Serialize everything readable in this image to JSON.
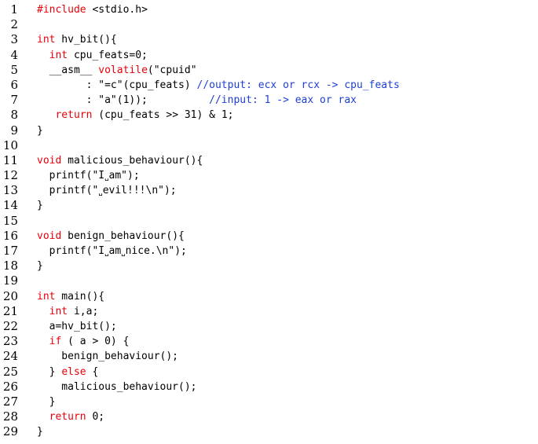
{
  "listing": {
    "language": "C",
    "lines": [
      {
        "n": "1",
        "tokens": [
          {
            "t": "#include",
            "c": "kw"
          },
          {
            "t": " <stdio.h>",
            "c": ""
          }
        ]
      },
      {
        "n": "2",
        "tokens": []
      },
      {
        "n": "3",
        "tokens": [
          {
            "t": "int",
            "c": "kw"
          },
          {
            "t": " hv_bit(){",
            "c": ""
          }
        ]
      },
      {
        "n": "4",
        "tokens": [
          {
            "t": "  ",
            "c": ""
          },
          {
            "t": "int",
            "c": "kw"
          },
          {
            "t": " cpu_feats=0;",
            "c": ""
          }
        ]
      },
      {
        "n": "5",
        "tokens": [
          {
            "t": "  __asm__ ",
            "c": ""
          },
          {
            "t": "volatile",
            "c": "kw"
          },
          {
            "t": "(\"cpuid\"",
            "c": ""
          }
        ]
      },
      {
        "n": "6",
        "tokens": [
          {
            "t": "        : \"=c\"(cpu_feats) ",
            "c": ""
          },
          {
            "t": "//output: ecx or rcx -> cpu_feats",
            "c": "cm"
          }
        ]
      },
      {
        "n": "7",
        "tokens": [
          {
            "t": "        : \"a\"(1));          ",
            "c": ""
          },
          {
            "t": "//input: 1 -> eax or rax",
            "c": "cm"
          }
        ]
      },
      {
        "n": "8",
        "tokens": [
          {
            "t": "   ",
            "c": ""
          },
          {
            "t": "return",
            "c": "kw"
          },
          {
            "t": " (cpu_feats >> 31) & 1;",
            "c": ""
          }
        ]
      },
      {
        "n": "9",
        "tokens": [
          {
            "t": "}",
            "c": ""
          }
        ]
      },
      {
        "n": "10",
        "tokens": []
      },
      {
        "n": "11",
        "tokens": [
          {
            "t": "void",
            "c": "kw"
          },
          {
            "t": " malicious_behaviour(){",
            "c": ""
          }
        ]
      },
      {
        "n": "12",
        "tokens": [
          {
            "t": "  printf(\"I",
            "c": ""
          },
          {
            "t": "␣",
            "c": "vs"
          },
          {
            "t": "am\");",
            "c": ""
          }
        ]
      },
      {
        "n": "13",
        "tokens": [
          {
            "t": "  printf(\"",
            "c": ""
          },
          {
            "t": "␣",
            "c": "vs"
          },
          {
            "t": "evil!!!\\n\");",
            "c": ""
          }
        ]
      },
      {
        "n": "14",
        "tokens": [
          {
            "t": "}",
            "c": ""
          }
        ]
      },
      {
        "n": "15",
        "tokens": []
      },
      {
        "n": "16",
        "tokens": [
          {
            "t": "void",
            "c": "kw"
          },
          {
            "t": " benign_behaviour(){",
            "c": ""
          }
        ]
      },
      {
        "n": "17",
        "tokens": [
          {
            "t": "  printf(\"I",
            "c": ""
          },
          {
            "t": "␣",
            "c": "vs"
          },
          {
            "t": "am",
            "c": ""
          },
          {
            "t": "␣",
            "c": "vs"
          },
          {
            "t": "nice.\\n\");",
            "c": ""
          }
        ]
      },
      {
        "n": "18",
        "tokens": [
          {
            "t": "}",
            "c": ""
          }
        ]
      },
      {
        "n": "19",
        "tokens": []
      },
      {
        "n": "20",
        "tokens": [
          {
            "t": "int",
            "c": "kw"
          },
          {
            "t": " main(){",
            "c": ""
          }
        ]
      },
      {
        "n": "21",
        "tokens": [
          {
            "t": "  ",
            "c": ""
          },
          {
            "t": "int",
            "c": "kw"
          },
          {
            "t": " i,a;",
            "c": ""
          }
        ]
      },
      {
        "n": "22",
        "tokens": [
          {
            "t": "  a=hv_bit();",
            "c": ""
          }
        ]
      },
      {
        "n": "23",
        "tokens": [
          {
            "t": "  ",
            "c": ""
          },
          {
            "t": "if",
            "c": "kw"
          },
          {
            "t": " ( a > 0) {",
            "c": ""
          }
        ]
      },
      {
        "n": "24",
        "tokens": [
          {
            "t": "    benign_behaviour();",
            "c": ""
          }
        ]
      },
      {
        "n": "25",
        "tokens": [
          {
            "t": "  } ",
            "c": ""
          },
          {
            "t": "else",
            "c": "kw"
          },
          {
            "t": " {",
            "c": ""
          }
        ]
      },
      {
        "n": "26",
        "tokens": [
          {
            "t": "    malicious_behaviour();",
            "c": ""
          }
        ]
      },
      {
        "n": "27",
        "tokens": [
          {
            "t": "  }",
            "c": ""
          }
        ]
      },
      {
        "n": "28",
        "tokens": [
          {
            "t": "  ",
            "c": ""
          },
          {
            "t": "return",
            "c": "kw"
          },
          {
            "t": " 0;",
            "c": ""
          }
        ]
      },
      {
        "n": "29",
        "tokens": [
          {
            "t": "}",
            "c": ""
          }
        ]
      }
    ]
  },
  "colors": {
    "keyword": "#e8000b",
    "comment": "#1e3fd6",
    "text": "#000000",
    "background": "#ffffff"
  }
}
